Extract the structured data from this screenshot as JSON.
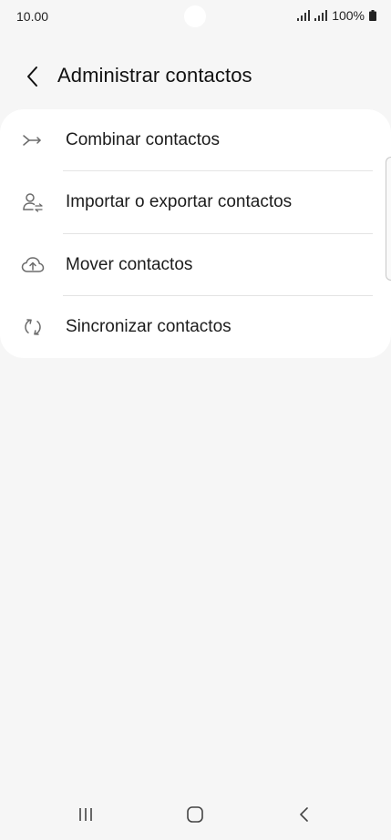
{
  "status_bar": {
    "time": "10.00",
    "battery": "100%"
  },
  "header": {
    "title": "Administrar contactos"
  },
  "menu": {
    "items": [
      {
        "label": "Combinar contactos",
        "icon": "merge-icon"
      },
      {
        "label": "Importar o exportar contactos",
        "icon": "import-export-contacts-icon"
      },
      {
        "label": "Mover contactos",
        "icon": "cloud-upload-icon"
      },
      {
        "label": "Sincronizar contactos",
        "icon": "sync-icon"
      }
    ]
  },
  "colors": {
    "background": "#f6f6f6",
    "card": "#ffffff",
    "divider": "#e4e4e4",
    "icon": "#6b6b6b",
    "text": "#1c1c1c"
  }
}
